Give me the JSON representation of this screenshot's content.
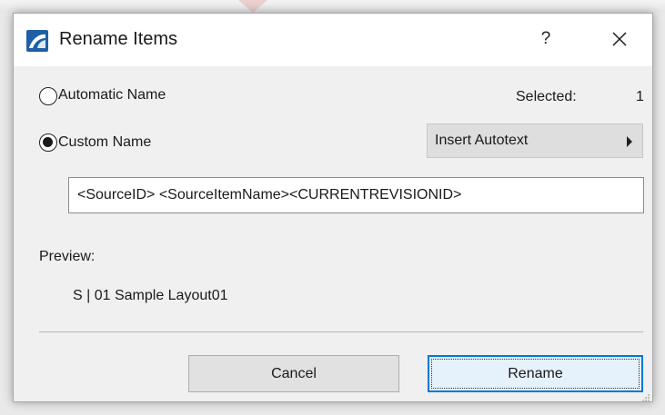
{
  "dialog": {
    "title": "Rename Items",
    "help_label": "?",
    "icon": "archicad-icon",
    "close_icon": "close-icon"
  },
  "options": {
    "automatic_label": "Automatic Name",
    "custom_label": "Custom Name",
    "selected_option": "Custom Name"
  },
  "selection": {
    "label": "Selected:",
    "count": "1"
  },
  "autotext": {
    "button_label": "Insert Autotext",
    "arrow_icon": "triangle-right-icon"
  },
  "name_field": {
    "value": "<SourceID>  <SourceItemName><CURRENTREVISIONID>"
  },
  "preview": {
    "label": "Preview:",
    "value": "S | 01 Sample Layout01"
  },
  "buttons": {
    "cancel_label": "Cancel",
    "rename_label": "Rename"
  },
  "colors": {
    "focus_border": "#0078d7",
    "dialog_bg": "#f0f0f0",
    "title_bg": "#ffffff"
  }
}
